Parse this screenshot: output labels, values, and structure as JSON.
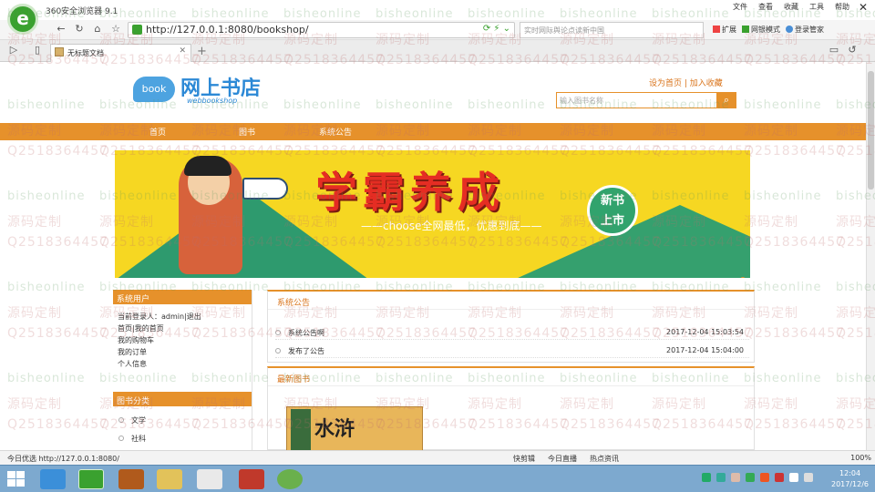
{
  "browser": {
    "logo_letter": "e",
    "title": "360安全浏览器 9.1",
    "menu": [
      "文件",
      "查看",
      "收藏",
      "工具",
      "帮助"
    ],
    "url": "http://127.0.0.1:8080/bookshop/",
    "search_placeholder": "实时网际舆论点读新中国",
    "tools": [
      "扩展",
      "网银模式",
      "登录管家"
    ],
    "tab_title": "无标题文档",
    "close_glyph": "✕"
  },
  "site": {
    "logo_badge": "book",
    "name": "网上书店",
    "subtitle": "webbookshop",
    "links": "设为首页 | 加入收藏",
    "search_placeholder": "输入图书名称",
    "nav": [
      "首页",
      "图书",
      "系统公告"
    ]
  },
  "banner": {
    "title": "学霸养成",
    "subtitle": "——choose全网最低，优惠到底——",
    "badge_line1": "新书",
    "badge_line2": "上市"
  },
  "sidebar": {
    "system_title": "系统用户",
    "login_text": "当前登录人：admin|退出",
    "links": [
      "首页|我的首页",
      "我的购物车",
      "我的订单",
      "个人信息"
    ],
    "category_title": "图书分类",
    "categories": [
      "文学",
      "社科"
    ]
  },
  "notices": {
    "title": "系统公告",
    "rows": [
      {
        "title": "系统公告啊",
        "date": "2017-12-04 15:03:54"
      },
      {
        "title": "发布了公告",
        "date": "2017-12-04 15:04:00"
      }
    ]
  },
  "newbooks": {
    "title": "最新图书",
    "cover_text": "水浒"
  },
  "status": {
    "left": "今日优选 http://127.0.0.1:8080/",
    "items": [
      "快剪辑",
      "今日直播",
      "热点资讯"
    ],
    "zoom": "100%"
  },
  "taskbar": {
    "time": "12:04",
    "date": "2017/12/6"
  },
  "watermark": {
    "a": "Q2518364457",
    "b": "bisheonline",
    "c": "源码定制"
  },
  "colors": {
    "accent": "#e6912b",
    "browser_green": "#3aa12f",
    "brand_blue": "#2c89d6"
  }
}
